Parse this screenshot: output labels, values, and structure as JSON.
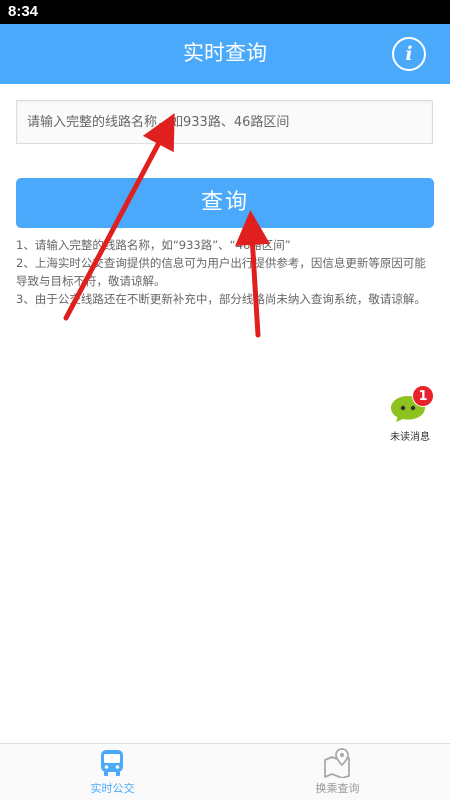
{
  "status_bar": {
    "time": "8:34"
  },
  "header": {
    "title": "实时查询",
    "info_icon": "info-icon"
  },
  "search": {
    "placeholder": "请输入完整的线路名称，如933路、46路区间",
    "value": ""
  },
  "query_button": {
    "label": "查询"
  },
  "notes": [
    "1、请输入完整的线路名称，如“933路”、“46路区间”",
    "2、上海实时公交查询提供的信息可为用户出行提供参考，因信息更新等原因可能导致与目标不符，敬请谅解。",
    "3、由于公交线路还在不断更新补充中，部分线路尚未纳入查询系统，敬请谅解。"
  ],
  "unread": {
    "badge_count": "1",
    "label": "未读消息",
    "icon": "chat-bubble-icon",
    "color": "#8dc21f"
  },
  "bottom_nav": [
    {
      "label": "实时公交",
      "icon": "bus-icon",
      "active": true
    },
    {
      "label": "换乘查询",
      "icon": "map-pin-icon",
      "active": false
    }
  ],
  "colors": {
    "primary": "#4aa9fb",
    "badge": "#e9232c",
    "annotation_arrow": "#e0201f"
  }
}
